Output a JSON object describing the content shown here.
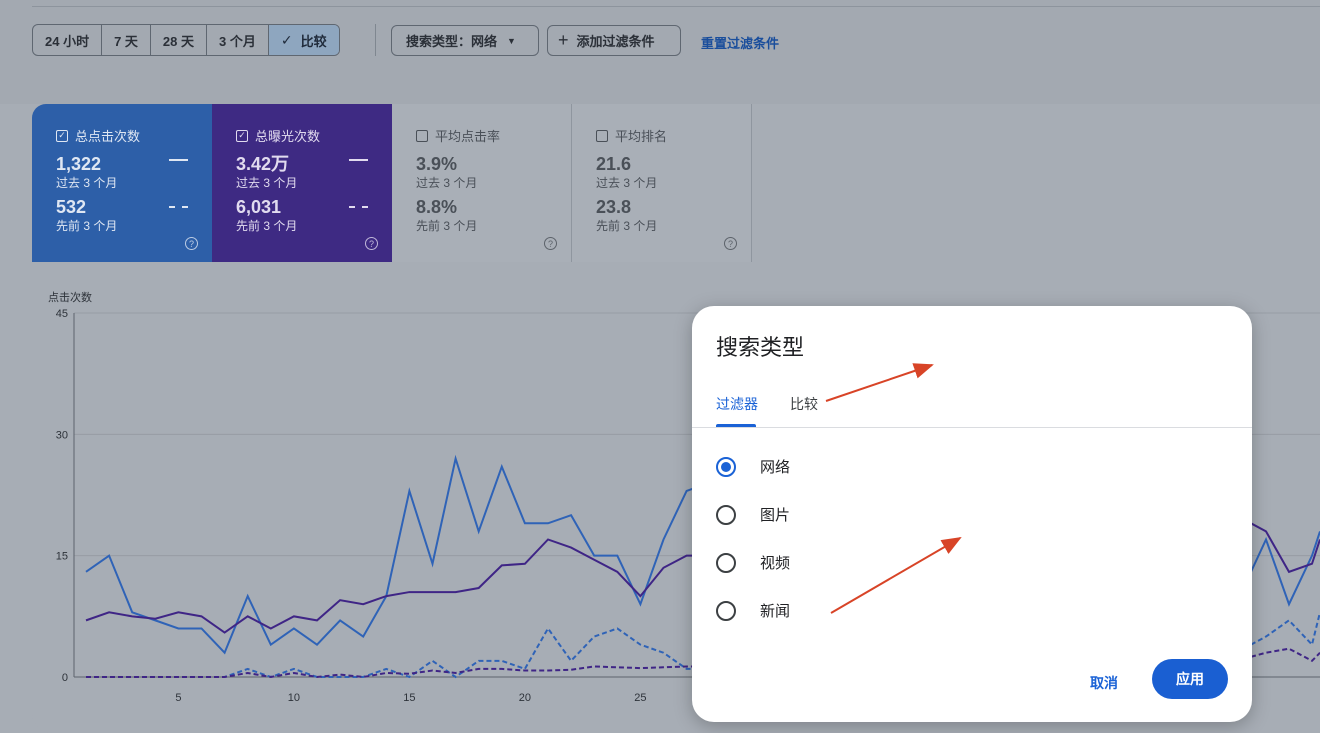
{
  "toolbar": {
    "ranges": [
      "24 小时",
      "7 天",
      "28 天",
      "3 个月",
      "比较"
    ],
    "search_type_chip": "搜索类型：网络",
    "add_filter": "添加过滤条件",
    "reset_filters": "重置过滤条件"
  },
  "metrics": [
    {
      "label": "总点击次数",
      "checked": true,
      "v1": "1,322",
      "s1": "过去 3 个月",
      "v2": "532",
      "s2": "先前 3 个月"
    },
    {
      "label": "总曝光次数",
      "checked": true,
      "v1": "3.42万",
      "s1": "过去 3 个月",
      "v2": "6,031",
      "s2": "先前 3 个月"
    },
    {
      "label": "平均点击率",
      "checked": false,
      "v1": "3.9%",
      "s1": "过去 3 个月",
      "v2": "8.8%",
      "s2": "先前 3 个月"
    },
    {
      "label": "平均排名",
      "checked": false,
      "v1": "21.6",
      "s1": "过去 3 个月",
      "v2": "23.8",
      "s2": "先前 3 个月"
    }
  ],
  "chart": {
    "ylabel": "点击次数",
    "yticks": [
      "45",
      "30",
      "15",
      "0"
    ],
    "xticks": [
      "5",
      "10",
      "15",
      "20",
      "25"
    ]
  },
  "chart_data": {
    "type": "line",
    "ylabel": "点击次数",
    "ylim": [
      0,
      45
    ],
    "x": [
      1,
      2,
      3,
      4,
      5,
      6,
      7,
      8,
      9,
      10,
      11,
      12,
      13,
      14,
      15,
      16,
      17,
      18,
      19,
      20,
      21,
      22,
      23,
      24,
      25,
      26,
      27,
      28
    ],
    "series": [
      {
        "values": [
          13,
          15,
          8,
          7,
          6,
          6,
          3,
          10,
          4,
          6,
          4,
          7,
          5,
          10,
          23,
          14,
          27,
          18,
          26,
          19,
          19,
          20,
          15,
          15,
          9,
          17,
          23,
          24
        ]
      },
      {
        "values": [
          7,
          8,
          7.5,
          7.2,
          8,
          7.5,
          5.5,
          7.5,
          6,
          7.5,
          7,
          9.5,
          9,
          10,
          10.5,
          10.5,
          10.5,
          11,
          13.8,
          14,
          17,
          16,
          14.5,
          13,
          10,
          13.5,
          15,
          15
        ]
      },
      {
        "values": [
          0,
          0,
          0,
          0,
          0,
          0,
          0,
          1,
          0,
          1,
          0,
          0,
          0,
          1,
          0,
          2,
          0,
          2,
          2,
          1,
          6,
          2,
          5,
          6,
          4,
          3,
          1,
          1
        ]
      },
      {
        "values": [
          0,
          0,
          0,
          0,
          0,
          0,
          0,
          0.5,
          0,
          0.5,
          0,
          0.3,
          0,
          0.5,
          0.4,
          0.8,
          0.5,
          1,
          1,
          0.8,
          0.8,
          0.9,
          1.3,
          1.2,
          1.1,
          1.2,
          1.3,
          1.3
        ]
      }
    ],
    "right_tail": {
      "x": [
        1251,
        1266,
        1289,
        1312,
        1320
      ],
      "series0": [
        13,
        17,
        9,
        15,
        18
      ],
      "series1": [
        19,
        18,
        13,
        14,
        17
      ],
      "series2": [
        4,
        5,
        7,
        4,
        8
      ],
      "series3": [
        2.5,
        3,
        3.5,
        2,
        3
      ]
    }
  },
  "colors": {
    "series0": "#2f63b7",
    "series1": "#3f2586",
    "series2": "#2f63b7",
    "series3": "#3f2586",
    "accent": "#1a62d6",
    "annotation": "#d84427"
  },
  "dialog": {
    "title": "搜索类型",
    "tabs": [
      "过滤器",
      "比较"
    ],
    "options": [
      "网络",
      "图片",
      "视频",
      "新闻"
    ],
    "selected": "网络",
    "cancel": "取消",
    "apply": "应用"
  }
}
